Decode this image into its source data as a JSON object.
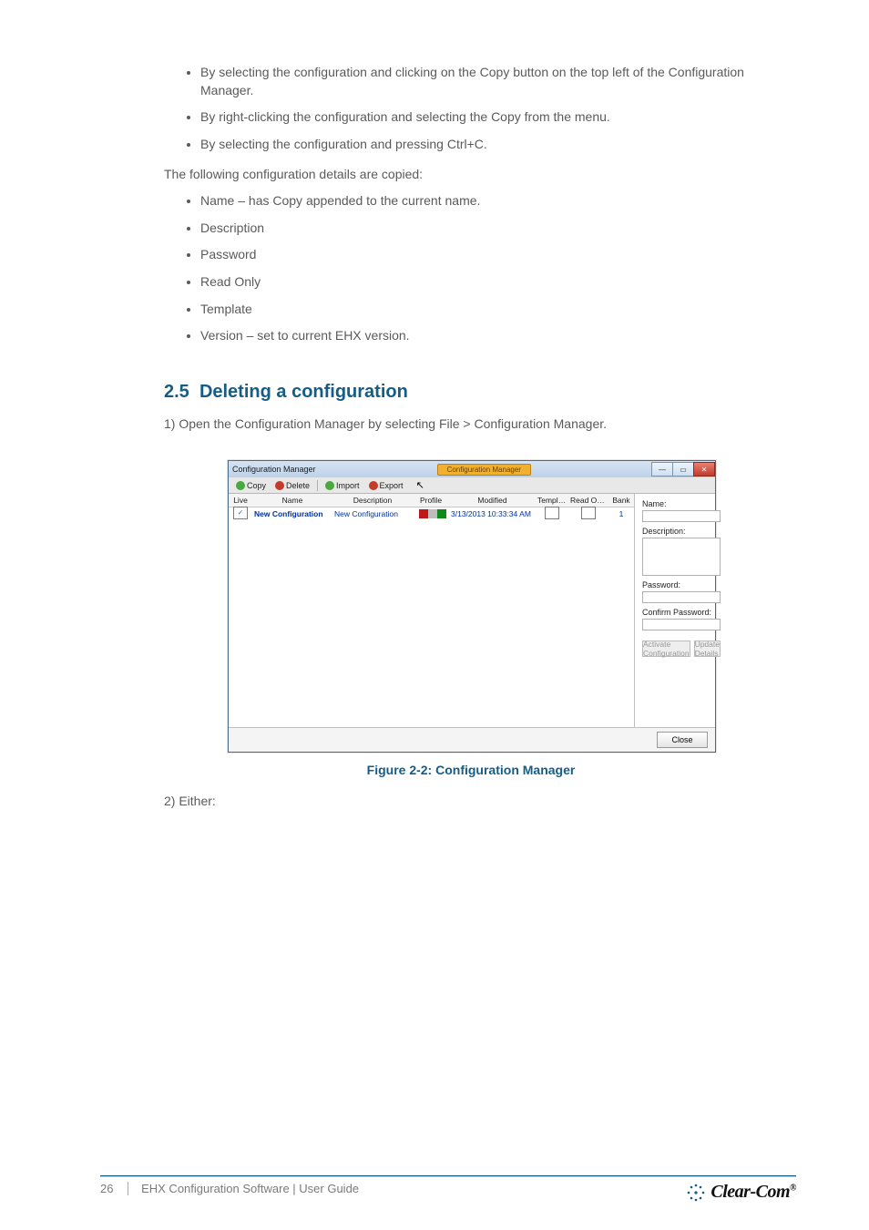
{
  "doc": {
    "proceduresA": [
      "By selecting the configuration and clicking on the Copy button on the top left of the Configuration Manager.",
      "By right-clicking the configuration and selecting the Copy from the menu.",
      "By selecting the configuration and pressing Ctrl+C."
    ],
    "introB": "The following configuration details are copied:",
    "detailsB": [
      "Name – has Copy appended to the current name.",
      "Description",
      "Password",
      "Read Only",
      "Template",
      "Version – set to current EHX version."
    ],
    "sectionNumber": "2.5",
    "sectionTitle": "Deleting a configuration",
    "steps": [
      {
        "num": "1)",
        "text": "Open the Configuration Manager by selecting File > Configuration Manager."
      },
      {
        "num": "2)",
        "prefix": "Either:"
      }
    ],
    "figureCaption": "Figure 2-2: Configuration Manager"
  },
  "win": {
    "title": "Configuration Manager",
    "titleBadge": "Configuration Manager",
    "ctrls": {
      "min": "—",
      "max": "▭",
      "close": "✕"
    },
    "toolbar": {
      "copy": "Copy",
      "delete": "Delete",
      "import": "Import",
      "export": "Export"
    },
    "cols": [
      "Live",
      "Name",
      "Description",
      "Profile",
      "Modified",
      "Template",
      "Read Only",
      "Bank"
    ],
    "row": {
      "live": true,
      "name": "New Configuration",
      "description": "New Configuration",
      "modified": "3/13/2013 10:33:34 AM",
      "template": false,
      "readOnly": false,
      "bank": "1",
      "profileColors": [
        "#c01818",
        "#bdbdbd",
        "#0f8a1a"
      ]
    },
    "right": {
      "nameLabel": "Name:",
      "descLabel": "Description:",
      "pwdLabel": "Password:",
      "confirmLabel": "Confirm Password:",
      "activateBtn": "Activate Configuration",
      "updateBtn": "Update Details"
    },
    "closeBtn": "Close"
  },
  "footer": {
    "page": "26",
    "line1": "EHX Configuration Software | User Guide",
    "brand": "Clear-Com",
    "reg": "®"
  }
}
